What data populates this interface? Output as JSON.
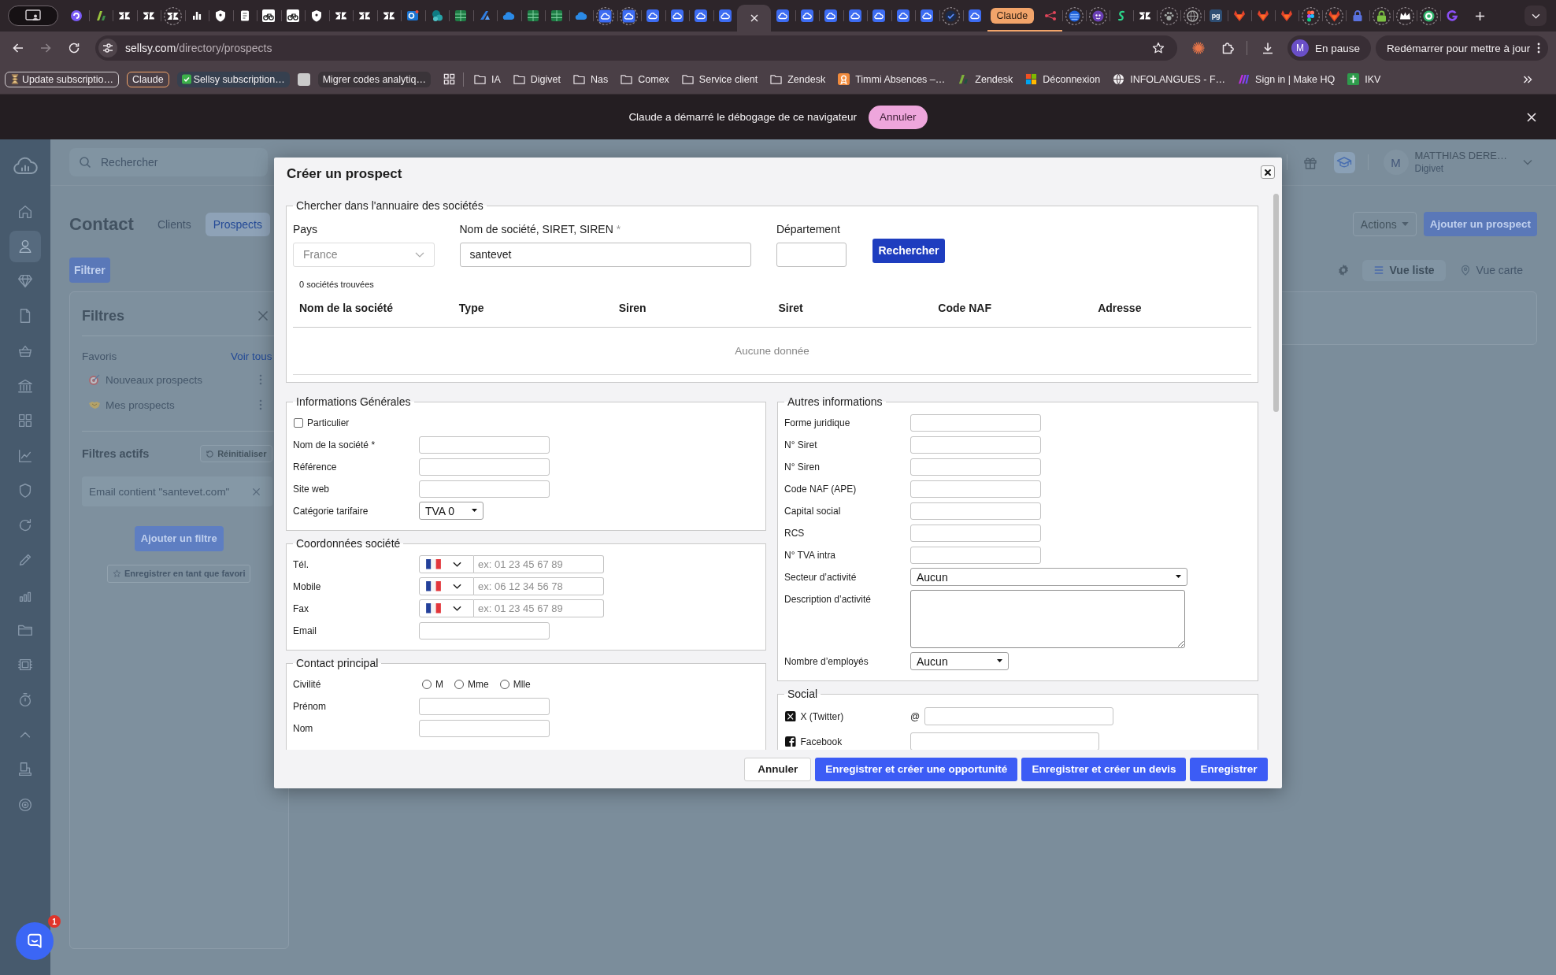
{
  "browser": {
    "tabs": [
      {
        "kind": "swirl",
        "discarded": false,
        "selected": false
      },
      {
        "kind": "slash",
        "discarded": false,
        "selected": false
      },
      {
        "kind": "triangles",
        "discarded": false,
        "selected": false
      },
      {
        "kind": "triangles",
        "discarded": false,
        "selected": false
      },
      {
        "kind": "triangles",
        "discarded": true,
        "selected": false
      },
      {
        "kind": "barchart",
        "discarded": false,
        "selected": false
      },
      {
        "kind": "shield",
        "discarded": false,
        "selected": false
      },
      {
        "kind": "document",
        "discarded": false,
        "selected": false
      },
      {
        "kind": "bike",
        "discarded": false,
        "selected": false
      },
      {
        "kind": "bike",
        "discarded": false,
        "selected": false
      },
      {
        "kind": "shield",
        "discarded": false,
        "selected": false
      },
      {
        "kind": "triangles",
        "discarded": false,
        "selected": false
      },
      {
        "kind": "triangles",
        "discarded": false,
        "selected": false
      },
      {
        "kind": "triangles",
        "discarded": false,
        "selected": false
      },
      {
        "kind": "mail",
        "discarded": false,
        "selected": false
      },
      {
        "kind": "share",
        "discarded": false,
        "selected": false
      },
      {
        "kind": "sheet",
        "discarded": false,
        "selected": false
      },
      {
        "kind": "wedge",
        "discarded": false,
        "selected": false
      },
      {
        "kind": "cloud",
        "discarded": false,
        "selected": false
      },
      {
        "kind": "sheet",
        "discarded": false,
        "selected": false
      },
      {
        "kind": "sheet",
        "discarded": false,
        "selected": false
      },
      {
        "kind": "cloud",
        "discarded": false,
        "selected": false
      },
      {
        "kind": "cloudtile",
        "discarded": true,
        "selected": false
      },
      {
        "kind": "cloudtile",
        "discarded": true,
        "selected": false
      },
      {
        "kind": "cloudtile",
        "discarded": false,
        "selected": false
      },
      {
        "kind": "cloudtile",
        "discarded": false,
        "selected": false
      },
      {
        "kind": "cloudtile",
        "discarded": false,
        "selected": false
      },
      {
        "kind": "cloudtile",
        "discarded": false,
        "selected": false
      },
      {
        "discarded": false,
        "selected": true
      },
      {
        "kind": "cloudtile",
        "discarded": false,
        "selected": false
      },
      {
        "kind": "cloudtile",
        "discarded": false,
        "selected": false
      },
      {
        "kind": "cloudtile",
        "discarded": false,
        "selected": false
      },
      {
        "kind": "cloudtile",
        "discarded": false,
        "selected": false
      },
      {
        "kind": "cloudtile",
        "discarded": false,
        "selected": false
      },
      {
        "kind": "cloudtile",
        "discarded": false,
        "selected": false
      },
      {
        "kind": "cloudtile",
        "discarded": false,
        "selected": false
      },
      {
        "kind": "check",
        "discarded": true,
        "selected": false
      },
      {
        "kind": "cloudtile",
        "discarded": false,
        "selected": false
      }
    ],
    "tab_group": {
      "label": "Claude",
      "tabs": [
        {
          "kind": "network",
          "discarded": false,
          "selected": false
        }
      ]
    },
    "tabs_more": [
      {
        "kind": "stripes",
        "discarded": true,
        "selected": false
      },
      {
        "kind": "face",
        "discarded": true,
        "selected": false
      },
      {
        "kind": "squiggle",
        "discarded": false,
        "selected": false
      },
      {
        "kind": "triangles",
        "discarded": false,
        "selected": false
      },
      {
        "kind": "paw",
        "discarded": true,
        "selected": false
      },
      {
        "kind": "globe",
        "discarded": true,
        "selected": false
      },
      {
        "kind": "letters",
        "label": "pg",
        "discarded": false,
        "selected": false
      },
      {
        "kind": "fox",
        "discarded": false,
        "selected": false
      },
      {
        "kind": "fox",
        "discarded": false,
        "selected": false
      },
      {
        "kind": "fox",
        "discarded": false,
        "selected": false
      },
      {
        "kind": "dots",
        "discarded": true,
        "selected": false
      },
      {
        "kind": "fox",
        "discarded": true,
        "selected": false
      },
      {
        "kind": "lock",
        "color": "#5a72e0",
        "discarded": false,
        "selected": false
      },
      {
        "kind": "lock",
        "color": "#7cc043",
        "discarded": true,
        "selected": false
      },
      {
        "kind": "crown",
        "discarded": true,
        "selected": false
      },
      {
        "kind": "target",
        "discarded": true,
        "selected": false
      },
      {
        "kind": "hook",
        "discarded": false,
        "selected": false
      }
    ],
    "address": {
      "host": "sellsy.com",
      "path": "/directory/prospects"
    },
    "profile": {
      "initial": "M",
      "status": "En pause"
    },
    "update": "Redémarrer pour mettre à jour",
    "bookmarks": [
      {
        "kind": "outlined",
        "color": "#d2cdd0",
        "label": "Update subscriptio…"
      },
      {
        "kind": "outlined",
        "color": "#f2a46a",
        "label": "Claude"
      },
      {
        "kind": "filled",
        "color": "#36404f",
        "label": "Sellsy subscription…"
      },
      {
        "kind": "swatch",
        "color": "#cacaca"
      },
      {
        "kind": "filled",
        "color": "#3a3439",
        "label": "Migrer codes analytiq…"
      },
      {
        "kind": "apps"
      },
      {
        "kind": "separator"
      },
      {
        "kind": "folder",
        "label": "IA"
      },
      {
        "kind": "folder",
        "label": "Digivet"
      },
      {
        "kind": "folder",
        "label": "Nas"
      },
      {
        "kind": "folder",
        "label": "Comex"
      },
      {
        "kind": "folder",
        "label": "Service client"
      },
      {
        "kind": "folder",
        "label": "Zendesk"
      },
      {
        "kind": "site",
        "label": "Timmi Absences –…"
      },
      {
        "kind": "site",
        "label": "Zendesk"
      },
      {
        "kind": "site",
        "label": "Déconnexion"
      },
      {
        "kind": "site",
        "label": "INFOLANGUES - F…"
      },
      {
        "kind": "site",
        "label": "Sign in | Make HQ"
      },
      {
        "kind": "site",
        "label": "IKV"
      }
    ]
  },
  "banner": {
    "message": "Claude a démarré le débogage de ce navigateur",
    "button": "Annuler"
  },
  "app": {
    "sidebar": [
      {
        "kind": "home",
        "selected": false
      },
      {
        "kind": "user",
        "selected": true
      },
      {
        "kind": "diamond",
        "selected": false
      },
      {
        "kind": "file",
        "selected": false
      },
      {
        "kind": "basket",
        "selected": false
      },
      {
        "kind": "bank",
        "selected": false
      },
      {
        "kind": "grid",
        "selected": false
      },
      {
        "kind": "trend",
        "selected": false
      },
      {
        "kind": "shield",
        "selected": false
      },
      {
        "kind": "refresh",
        "selected": false
      },
      {
        "kind": "pencil",
        "selected": false
      },
      {
        "kind": "bars",
        "selected": false
      },
      {
        "kind": "folder",
        "selected": false
      },
      {
        "kind": "stamp",
        "selected": false
      },
      {
        "kind": "timer",
        "selected": false
      },
      {
        "kind": "collapse",
        "selected": false
      },
      {
        "kind": "stand",
        "selected": false
      },
      {
        "kind": "target",
        "selected": false
      }
    ],
    "search": {
      "placeholder": "Rechercher"
    },
    "header_icons": [
      {
        "kind": "gift",
        "active": false
      },
      {
        "kind": "cap",
        "active": true
      }
    ],
    "user": {
      "initial": "M",
      "name": "MATTHIAS DERE…",
      "company": "Digivet"
    },
    "title": "Contact",
    "tabs": [
      {
        "label": "Clients",
        "selected": false
      },
      {
        "label": "Prospects",
        "selected": true
      }
    ],
    "actions": "Actions",
    "add": "Ajouter un prospect",
    "filter": "Filtrer",
    "views": [
      {
        "kind": "list",
        "label": "Vue liste",
        "selected": true
      },
      {
        "kind": "map",
        "label": "Vue carte",
        "selected": false
      }
    ],
    "filters": {
      "title": "Filtres",
      "favorites_label": "Favoris",
      "see_all": "Voir tous",
      "favorites": [
        {
          "label": "Nouveaux prospects"
        },
        {
          "label": "Mes prospects"
        }
      ],
      "active_label": "Filtres actifs",
      "reset": "Réinitialiser",
      "active": [
        {
          "label": "Email contient \"santevet.com\""
        }
      ],
      "add": "Ajouter un filtre",
      "save": "Enregistrer en tant que favori"
    },
    "chat": {
      "badge": "1"
    }
  },
  "modal": {
    "title": "Créer un prospect",
    "search": {
      "legend": "Chercher dans l'annuaire des sociétés",
      "country_label": "Pays",
      "country": "France",
      "query_label": "Nom de société, SIRET, SIREN",
      "query_mark": "*",
      "query": "santevet",
      "department_label": "Département",
      "button": "Rechercher",
      "result_count": "0 sociétés trouvées",
      "columns": [
        "Nom de la société",
        "Type",
        "Siren",
        "Siret",
        "Code NAF",
        "Adresse"
      ],
      "empty": "Aucune donnée"
    },
    "left_sections": [
      {
        "legend": "Informations Générales",
        "fields": [
          {
            "kind": "checkbox",
            "label": "Particulier",
            "checked": false
          },
          {
            "kind": "text",
            "label": "Nom de la société *"
          },
          {
            "kind": "text",
            "label": "Référence"
          },
          {
            "kind": "text",
            "label": "Site web"
          },
          {
            "kind": "select",
            "label": "Catégorie tarifaire",
            "value": "TVA 0"
          }
        ]
      },
      {
        "legend": "Coordonnées société",
        "fields": [
          {
            "kind": "phone",
            "label": "Tél.",
            "placeholder": "ex: 01 23 45 67 89"
          },
          {
            "kind": "phone",
            "label": "Mobile",
            "placeholder": "ex: 06 12 34 56 78"
          },
          {
            "kind": "phone",
            "label": "Fax",
            "placeholder": "ex: 01 23 45 67 89"
          },
          {
            "kind": "text",
            "label": "Email"
          }
        ]
      },
      {
        "legend": "Contact principal",
        "fields": [
          {
            "kind": "radio",
            "label": "Civilité",
            "options": [
              {
                "label": "M",
                "selected": false
              },
              {
                "label": "Mme",
                "selected": false
              },
              {
                "label": "Mlle",
                "selected": false
              }
            ]
          },
          {
            "kind": "text",
            "label": "Prénom"
          },
          {
            "kind": "text",
            "label": "Nom"
          }
        ]
      }
    ],
    "right_sections": [
      {
        "legend": "Autres informations",
        "fields": [
          {
            "kind": "text",
            "label": "Forme juridique"
          },
          {
            "kind": "text",
            "label": "N° Siret"
          },
          {
            "kind": "text",
            "label": "N° Siren"
          },
          {
            "kind": "text",
            "label": "Code NAF (APE)"
          },
          {
            "kind": "text",
            "label": "Capital social"
          },
          {
            "kind": "text",
            "label": "RCS"
          },
          {
            "kind": "text",
            "label": "N° TVA intra"
          },
          {
            "kind": "longselect",
            "label": "Secteur d’activité",
            "value": "Aucun"
          },
          {
            "kind": "textarea",
            "label": "Description d’activité"
          },
          {
            "kind": "select",
            "label": "Nombre d’employés",
            "value": "Aucun"
          }
        ]
      },
      {
        "legend": "Social",
        "fields": [
          {
            "kind": "handle",
            "label": "X (Twitter)",
            "prefix": "@"
          },
          {
            "kind": "link",
            "label": "Facebook"
          }
        ]
      }
    ],
    "buttons": [
      {
        "kind": "secondary",
        "label": "Annuler"
      },
      {
        "kind": "primary",
        "label": "Enregistrer et créer une opportunité"
      },
      {
        "kind": "primary",
        "label": "Enregistrer et créer un devis"
      },
      {
        "kind": "primary",
        "label": "Enregistrer"
      }
    ]
  }
}
